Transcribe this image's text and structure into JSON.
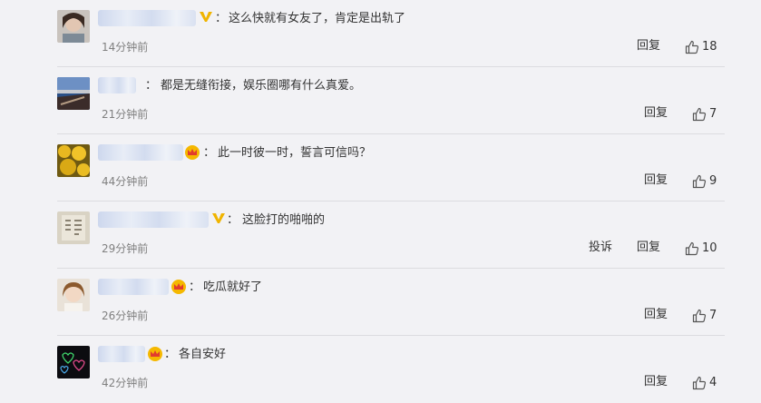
{
  "comments": [
    {
      "text": "这么快就有女友了，肯定是出轨了",
      "time": "14分钟前",
      "reply": "回复",
      "likes": "18",
      "badge": "v"
    },
    {
      "text": "都是无缝衔接，娱乐圈哪有什么真爱。",
      "time": "21分钟前",
      "reply": "回复",
      "likes": "7",
      "badge": "none"
    },
    {
      "text": "此一时彼一时，誓言可信吗？",
      "time": "44分钟前",
      "reply": "回复",
      "likes": "9",
      "badge": "crown"
    },
    {
      "text": "这脸打的啪啪的",
      "time": "29分钟前",
      "reply": "回复",
      "report": "投诉",
      "likes": "10",
      "badge": "v"
    },
    {
      "text": "吃瓜就好了",
      "time": "26分钟前",
      "reply": "回复",
      "likes": "7",
      "badge": "crown"
    },
    {
      "text": "各自安好",
      "time": "42分钟前",
      "reply": "回复",
      "likes": "4",
      "badge": "crown"
    }
  ],
  "colon": "：",
  "icons": {
    "like": "thumbs-up-icon",
    "v_badge": "verified-v-icon",
    "crown_badge": "crown-icon"
  },
  "colors": {
    "background": "#f2f2f5",
    "v_badge": "#f0b400",
    "crown": "#f5b800",
    "time": "#808080"
  }
}
